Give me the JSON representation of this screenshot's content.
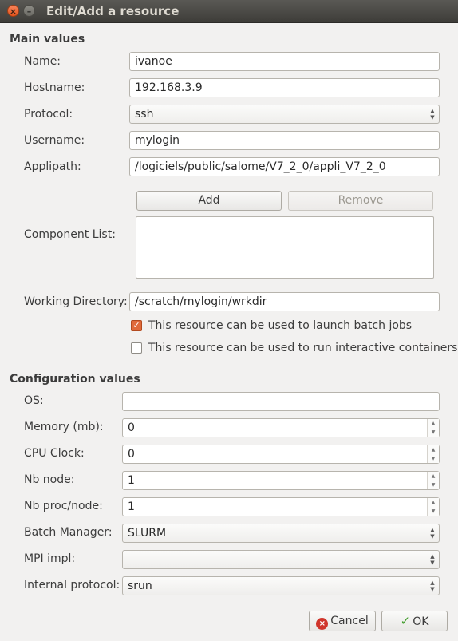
{
  "window": {
    "title": "Edit/Add a resource"
  },
  "main": {
    "heading": "Main values",
    "name_label": "Name:",
    "name_value": "ivanoe",
    "hostname_label": "Hostname:",
    "hostname_value": "192.168.3.9",
    "protocol_label": "Protocol:",
    "protocol_value": "ssh",
    "username_label": "Username:",
    "username_value": "mylogin",
    "applipath_label": "Applipath:",
    "applipath_value": "/logiciels/public/salome/V7_2_0/appli_V7_2_0",
    "add_label": "Add",
    "remove_label": "Remove",
    "component_list_label": "Component List:",
    "workdir_label": "Working Directory:",
    "workdir_value": "/scratch/mylogin/wrkdir",
    "batch_jobs_label": "This resource can be used to launch batch jobs",
    "batch_jobs_checked": true,
    "interactive_label": "This resource can be used to run interactive containers",
    "interactive_checked": false
  },
  "config": {
    "heading": "Configuration values",
    "os_label": "OS:",
    "os_value": "",
    "memory_label": "Memory (mb):",
    "memory_value": "0",
    "cpu_label": "CPU Clock:",
    "cpu_value": "0",
    "nbnode_label": "Nb node:",
    "nbnode_value": "1",
    "nbproc_label": "Nb proc/node:",
    "nbproc_value": "1",
    "batch_manager_label": "Batch Manager:",
    "batch_manager_value": "SLURM",
    "mpi_label": "MPI impl:",
    "mpi_value": "",
    "internal_protocol_label": "Internal protocol:",
    "internal_protocol_value": "srun"
  },
  "footer": {
    "cancel_label": "Cancel",
    "ok_label": "OK"
  },
  "colors": {
    "accent_checkbox": "#e06a3b",
    "cancel_icon": "#d0352b",
    "ok_icon": "#3f9c2a"
  }
}
